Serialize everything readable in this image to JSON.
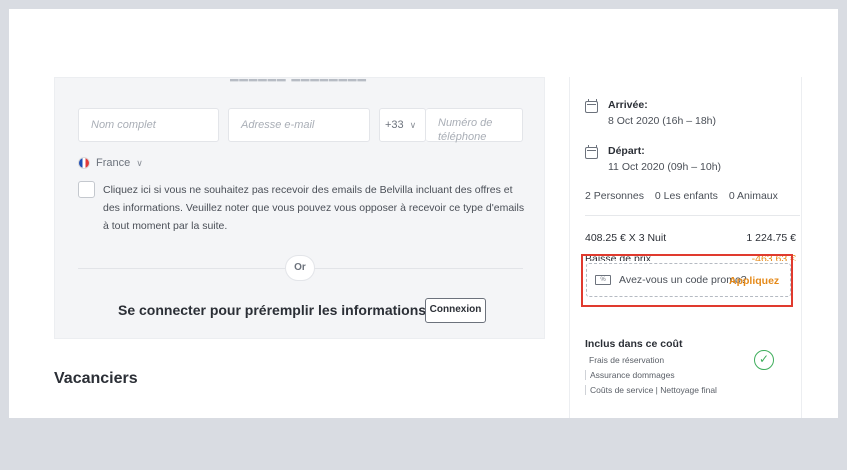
{
  "form": {
    "name_placeholder": "Nom complet",
    "email_placeholder": "Adresse e-mail",
    "country_code": "+33",
    "phone_placeholder": "Numéro de téléphone",
    "country": "France",
    "consent_text": "Cliquez ici si vous ne souhaitez pas recevoir des emails de Belvilla incluant des offres et des informations. Veuillez noter que vous pouvez vous opposer à recevoir ce type d'emails à tout moment par la suite.",
    "or_label": "Or",
    "prefill_label": "Se connecter pour préremplir les informations",
    "login_button": "Connexion"
  },
  "section": {
    "vacanciers_title": "Vacanciers"
  },
  "summary": {
    "arrival_label": "Arrivée:",
    "arrival_value": "8 Oct 2020 (16h – 18h)",
    "departure_label": "Départ:",
    "departure_value": "11 Oct 2020 (09h – 10h)",
    "guests": {
      "persons": "2 Personnes",
      "children": "0 Les enfants",
      "animals": "0 Animaux"
    },
    "price_line_label": "408.25 € X 3 Nuit",
    "price_line_amount": "1 224.75 €",
    "discount_label": "Baisse de prix",
    "discount_amount": "-463.63 €",
    "promo_text": "Avez-vous un code promo?",
    "promo_apply": "Appliquez",
    "included_title": "Inclus dans ce coût",
    "included_items": [
      "Frais de réservation",
      "Assurance dommages",
      "Coûts de service | Nettoyage final"
    ]
  },
  "icons": {
    "calendar": "calendar-icon",
    "promo": "promo-ticket-icon",
    "check": "check-circle-icon",
    "flag": "france-flag-icon"
  },
  "colors": {
    "accent_orange": "#e58a1a",
    "highlight_red": "#e03a2e",
    "check_green": "#3fae5c",
    "card_bg": "#f4f5f7"
  }
}
